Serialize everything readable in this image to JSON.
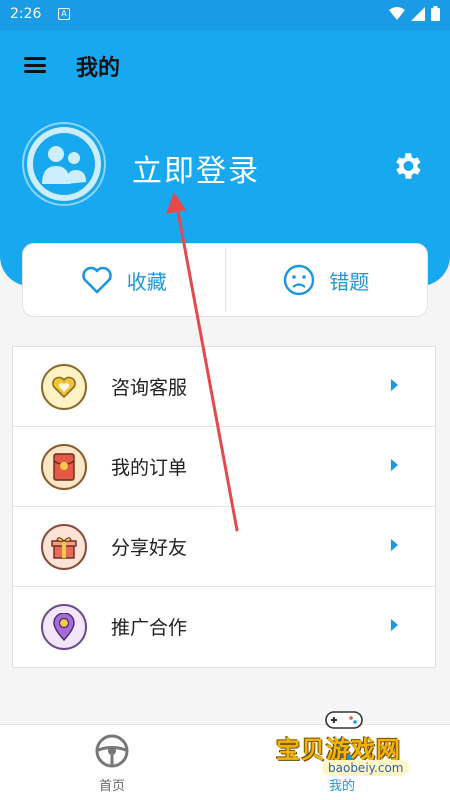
{
  "status_bar": {
    "time": "2:26",
    "notification_icon": "A"
  },
  "app_bar": {
    "title": "我的"
  },
  "header": {
    "login_label": "立即登录"
  },
  "quick_actions": [
    {
      "label": "收藏",
      "icon": "heart-icon"
    },
    {
      "label": "错题",
      "icon": "sad-face-icon"
    }
  ],
  "menu": [
    {
      "label": "咨询客服",
      "icon": "heart-badge-icon",
      "color": "#f2c232"
    },
    {
      "label": "我的订单",
      "icon": "red-envelope-icon",
      "color": "#e55a46"
    },
    {
      "label": "分享好友",
      "icon": "gift-icon",
      "color": "#e86b5a"
    },
    {
      "label": "推广合作",
      "icon": "location-pin-icon",
      "color": "#a56bd8"
    }
  ],
  "tabs": [
    {
      "label": "首页",
      "icon": "steering-wheel-icon"
    },
    {
      "label": "我的",
      "icon": "user-icon"
    }
  ],
  "watermark": {
    "text": "宝贝游戏网",
    "url": "baobeiy.com"
  },
  "colors": {
    "primary": "#18a8f0",
    "accent": "#1a97de",
    "annotation_arrow": "#e5484d"
  }
}
